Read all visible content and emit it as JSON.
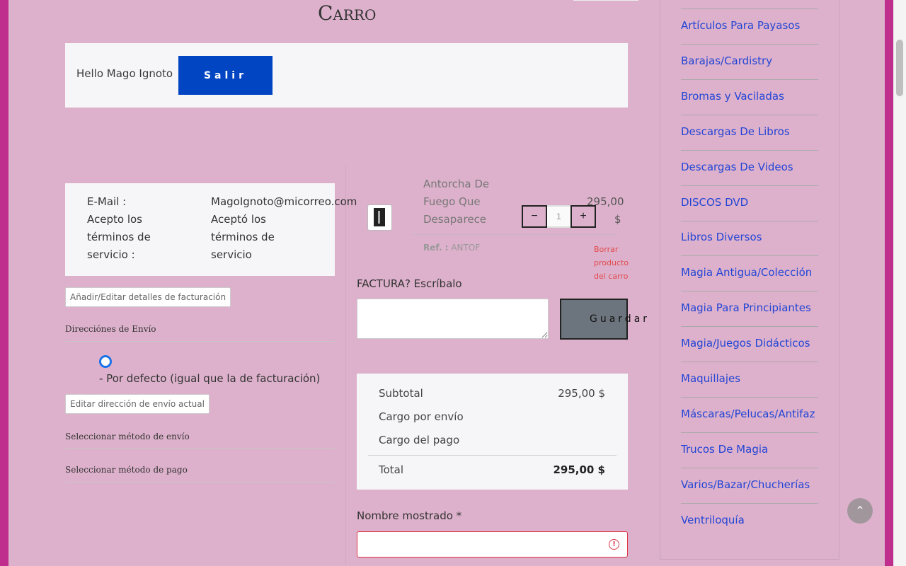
{
  "page_title": "Carro",
  "greeting": "Hello Mago Ignoto",
  "logout_label": "Salir",
  "account": {
    "email_label": "E-Mail :",
    "email_value": "MagoIgnoto@micorreo.com",
    "tos_label": "Acepto los términos de servicio :",
    "tos_value": "Aceptó los términos de servicio",
    "edit_billing_label": "Añadir/Editar detalles de facturación"
  },
  "shipping": {
    "heading": "Direcciónes de Envío",
    "default_option": "- Por defecto (igual que la de facturación)",
    "edit_label": "Editar dirección de envío actual",
    "method_heading": "Seleccionar método de envío",
    "payment_heading": "Seleccionar método de pago"
  },
  "cart_item": {
    "name": "Antorcha De Fuego Que Desaparece",
    "price": "295,00",
    "currency": "$",
    "quantity": "1",
    "ref_label": "Ref. :",
    "ref_value": "ANTOF",
    "delete_label": "Borrar producto del carro",
    "minus": "−",
    "plus": "+"
  },
  "factura": {
    "label": "FACTURA? Escríbalo",
    "save_label": "Guardar"
  },
  "totals": {
    "subtotal_label": "Subtotal",
    "subtotal_value": "295,00 $",
    "shipping_label": "Cargo por envío",
    "payment_label": "Cargo del pago",
    "total_label": "Total",
    "total_value": "295,00 $"
  },
  "display_name_label": "Nombre mostrado *",
  "categories": [
    "Artículos Para Payasos",
    "Barajas/Cardistry",
    "Bromas y Vaciladas",
    "Descargas De Libros",
    "Descargas De Videos",
    "DISCOS DVD",
    "Libros Diversos",
    "Magia Antigua/Colección",
    "Magia Para Principiantes",
    "Magia/Juegos Didácticos",
    "Maquillajes",
    "Máscaras/Pelucas/Antifaz",
    "Trucos De Magia",
    "Varios/Bazar/Chucherías",
    "Ventriloquía"
  ],
  "icons": {
    "warning": "warning-icon",
    "back_to_top": "chevron-up-icon"
  },
  "colors": {
    "background": "#ddb1cb",
    "accent": "#0145c3",
    "link": "#2345d6",
    "error": "#dc3545"
  }
}
